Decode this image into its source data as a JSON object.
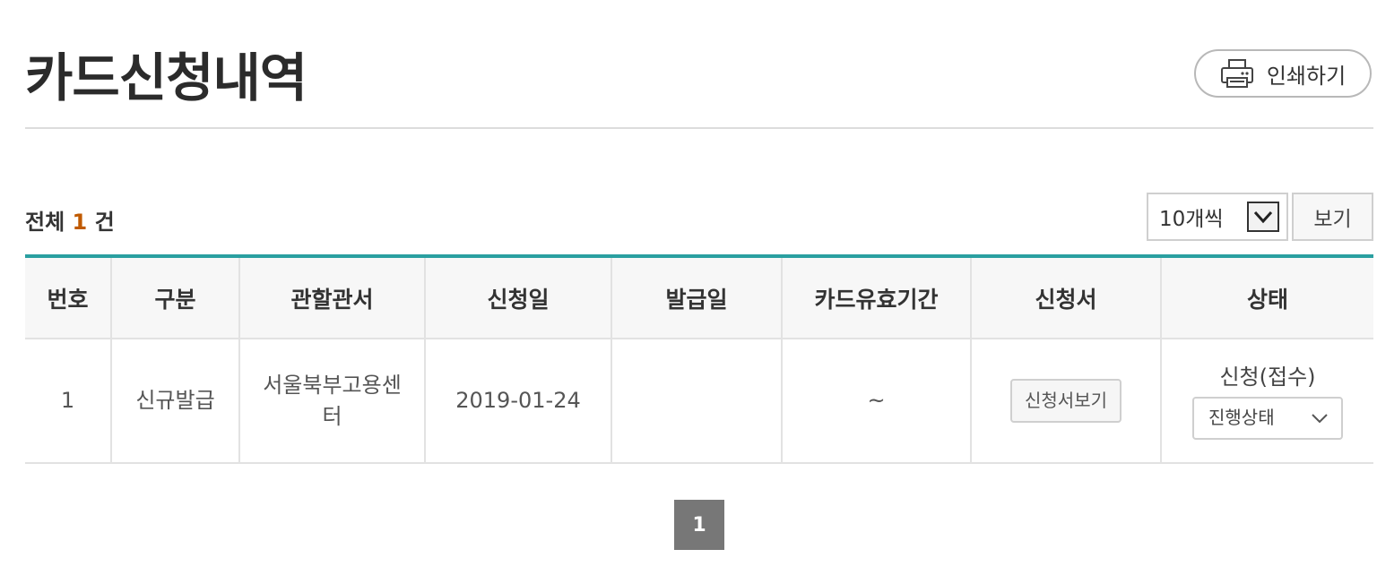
{
  "header": {
    "title": "카드신청내역",
    "print_label": "인쇄하기"
  },
  "summary": {
    "prefix": "전체",
    "count": "1",
    "suffix": "건"
  },
  "controls": {
    "page_size_value": "10개씩",
    "view_label": "보기"
  },
  "table": {
    "columns": [
      "번호",
      "구분",
      "관할관서",
      "신청일",
      "발급일",
      "카드유효기간",
      "신청서",
      "상태"
    ],
    "rows": [
      {
        "no": "1",
        "type": "신규발급",
        "office_line1": "서울북부고용센",
        "office_line2": "터",
        "apply_date": "2019-01-24",
        "issue_date": "",
        "validity": "~",
        "doc_button": "신청서보기",
        "status": "신청(접수)",
        "status_select": "진행상태"
      }
    ]
  },
  "pagination": {
    "current": "1"
  },
  "colors": {
    "accent_line": "#2a9fa0",
    "count_highlight": "#c05a00",
    "pager_bg": "#777777"
  },
  "icons": {
    "print": "printer-icon",
    "page_size_dropdown": "chevron-down-icon",
    "status_dropdown": "chevron-down-icon"
  }
}
